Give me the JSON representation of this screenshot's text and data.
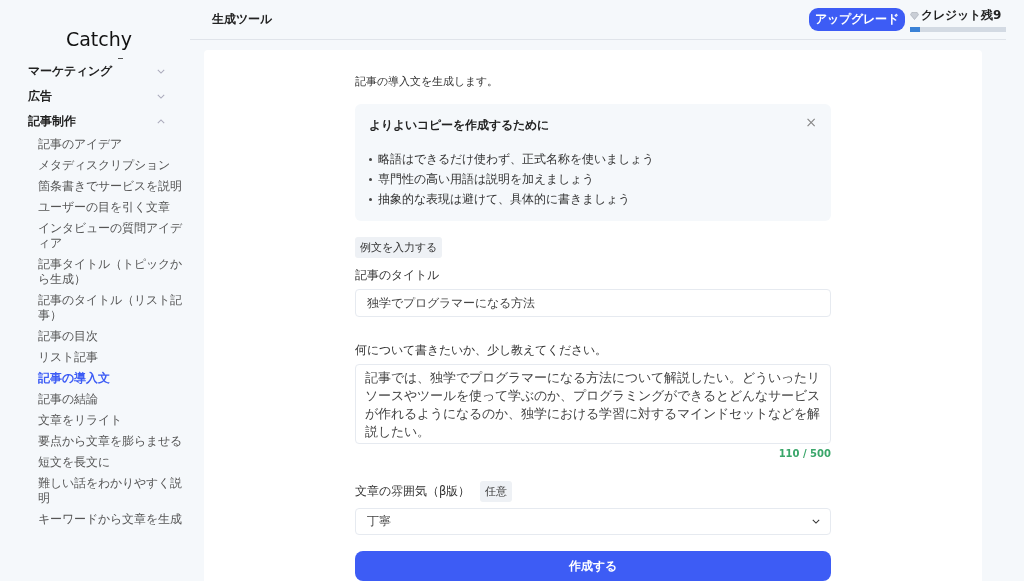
{
  "sidebar": {
    "logo": "Catchy",
    "sections": [
      {
        "label": "マーケティング",
        "expanded": false
      },
      {
        "label": "広告",
        "expanded": false
      },
      {
        "label": "記事制作",
        "expanded": true,
        "items": [
          {
            "label": "記事のアイデア",
            "selected": false
          },
          {
            "label": "メタディスクリプション",
            "selected": false
          },
          {
            "label": "箇条書きでサービスを説明",
            "selected": false
          },
          {
            "label": "ユーザーの目を引く文章",
            "selected": false
          },
          {
            "label": "インタビューの質問アイディア",
            "selected": false
          },
          {
            "label": "記事タイトル（トピックから生成）",
            "selected": false
          },
          {
            "label": "記事のタイトル（リスト記事）",
            "selected": false
          },
          {
            "label": "記事の目次",
            "selected": false
          },
          {
            "label": "リスト記事",
            "selected": false
          },
          {
            "label": "記事の導入文",
            "selected": true
          },
          {
            "label": "記事の結論",
            "selected": false
          },
          {
            "label": "文章をリライト",
            "selected": false
          },
          {
            "label": "要点から文章を膨らませる",
            "selected": false
          },
          {
            "label": "短文を長文に",
            "selected": false
          },
          {
            "label": "難しい話をわかりやすく説明",
            "selected": false
          },
          {
            "label": "キーワードから文章を生成",
            "selected": false
          }
        ]
      }
    ]
  },
  "header": {
    "title": "生成ツール",
    "upgrade": "アップグレード",
    "credits": "クレジット残9",
    "credit_bar": {
      "level": 0.1
    }
  },
  "form": {
    "description": "記事の導入文を生成します。",
    "tips": {
      "title": "よりよいコピーを作成するために",
      "close": "×",
      "items": [
        "略語はできるだけ使わず、正式名称を使いましょう",
        "専門性の高い用語は説明を加えましょう",
        "抽象的な表現は避けて、具体的に書きましょう"
      ]
    },
    "example_button": "例文を入力する",
    "fields": [
      {
        "kind": "input",
        "label": "記事のタイトル",
        "value": "独学でプログラマーになる方法"
      },
      {
        "kind": "textarea",
        "label": "何について書きたいか、少し教えてください。",
        "value": "記事では、独学でプログラマーになる方法について解説したい。どういったリソースやツールを使って学ぶのか、プログラミングができるとどんなサービスが作れるようになるのか、独学における学習に対するマインドセットなどを解説したい。",
        "counter": "110 / 500"
      },
      {
        "kind": "select",
        "label": "文章の雰囲気（β版）",
        "badge": "任意",
        "value": "丁寧"
      }
    ],
    "submit": "作成する"
  }
}
